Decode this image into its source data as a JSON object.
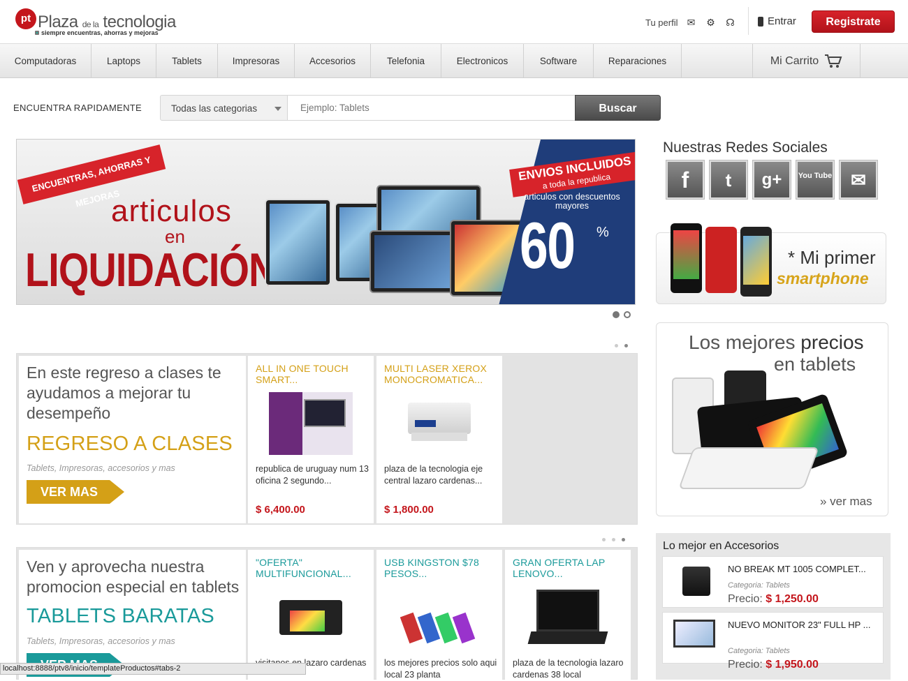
{
  "header": {
    "logo_mark": "pt",
    "logo_name_a": "Plaza",
    "logo_name_b": "de la",
    "logo_name_c": "tecnologia",
    "logo_tagline": "siempre encuentras, ahorras y mejoras",
    "profile_label": "Tu perfil",
    "login_label": "Entrar",
    "register_label": "Registrate"
  },
  "nav": {
    "items": [
      "Computadoras",
      "Laptops",
      "Tablets",
      "Impresoras",
      "Accesorios",
      "Telefonia",
      "Electronicos",
      "Software",
      "Reparaciones"
    ],
    "cart_label": "Mi Carrito"
  },
  "search": {
    "label": "ENCUENTRA RAPIDAMENTE",
    "category_selected": "Todas las categorias",
    "placeholder": "Ejemplo: Tablets",
    "button_label": "Buscar"
  },
  "hero": {
    "ribbon": "ENCUENTRAS, AHORRAS Y MEJORAS",
    "line1": "articulos",
    "line2": "en",
    "line3": "LIQUIDACIÓN",
    "envios_title": "ENVIOS INCLUIDOS",
    "envios_sub": "a toda la republica",
    "discount_desc": "articulos con descuentos mayores",
    "discount_value": "60",
    "discount_unit": "%"
  },
  "promo1": {
    "text": "En este regreso a clases te ayudamos a mejorar tu desempeño",
    "title": "REGRESO A CLASES",
    "subtitle": "Tablets, Impresoras, accesorios y mas",
    "button_label": "VER MAS",
    "accent": "#d4a017",
    "products": [
      {
        "name": "ALL IN ONE TOUCH SMART...",
        "desc": "republica de uruguay num 13 oficina 2 segundo...",
        "price": "$ 6,400.00"
      },
      {
        "name": "MULTI LASER XEROX MONOCROMATICA...",
        "desc": "plaza de la tecnologia eje central lazaro cardenas...",
        "price": "$ 1,800.00"
      }
    ]
  },
  "promo2": {
    "text": "Ven y aprovecha nuestra promocion especial en tablets",
    "title": "TABLETS BARATAS",
    "subtitle": "Tablets, Impresoras, accesorios y mas",
    "button_label": "VER MAS",
    "accent": "#1a9a9a",
    "products": [
      {
        "name": "\"OFERTA\" MULTIFUNCIONAL...",
        "desc": "visitanos en lazaro cardenas"
      },
      {
        "name": "USB KINGSTON $78 PESOS...",
        "desc": "los mejores precios solo aqui local 23 planta"
      },
      {
        "name": "GRAN OFERTA LAP LENOVO...",
        "desc": "plaza de la tecnologia lazaro cardenas 38 local"
      }
    ]
  },
  "sidebar": {
    "social_title": "Nuestras Redes Sociales",
    "social_icons": [
      "facebook-icon",
      "twitter-icon",
      "googleplus-icon",
      "youtube-icon",
      "mail-icon"
    ],
    "social_glyphs": [
      "f",
      "t",
      "g+",
      "You Tube",
      "✉"
    ],
    "smart_line1": "* Mi primer",
    "smart_line2": "smartphone",
    "tablets_line1a": "Los mejores ",
    "tablets_line1b": "precios",
    "tablets_line2": "en tablets",
    "tablets_link": "» ver mas",
    "accessories_title": "Lo mejor en Accesorios",
    "accessories": [
      {
        "name": "NO BREAK MT 1005 COMPLET...",
        "category": "Categoria: Tablets",
        "price_label": "Precio:",
        "price": "$ 1,250.00"
      },
      {
        "name": "NUEVO MONITOR 23\" FULL HP ...",
        "category": "Categoria: Tablets",
        "price_label": "Precio:",
        "price": "$ 1,950.00"
      }
    ]
  },
  "status_url": "localhost:8888/ptv8/inicio/templateProductos#tabs-2"
}
